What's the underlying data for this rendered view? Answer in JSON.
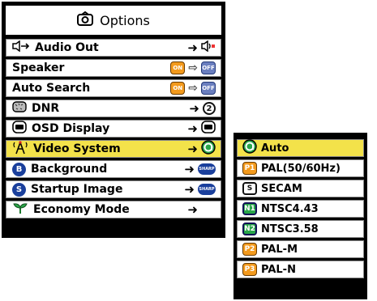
{
  "menu": {
    "title": "Options",
    "items": [
      {
        "label": "Audio Out",
        "icon": "audio-out-icon",
        "value_arrow": "➜",
        "value_icon": "speaker-out-icon",
        "selected": false
      },
      {
        "label": "Speaker",
        "icon": "",
        "value_on": "ON",
        "value_arrow": "⇨",
        "value_off": "OFF",
        "selected": false
      },
      {
        "label": "Auto Search",
        "icon": "",
        "value_on": "ON",
        "value_arrow": "⇨",
        "value_off": "OFF",
        "selected": false
      },
      {
        "label": "DNR",
        "icon": "dnr-icon",
        "value_arrow": "➜",
        "value_icon_text": "2",
        "selected": false
      },
      {
        "label": "OSD Display",
        "icon": "osd-icon",
        "value_arrow": "➜",
        "selected": false
      },
      {
        "label": "Video System",
        "icon": "video-system-icon",
        "value_arrow": "➜",
        "selected": true
      },
      {
        "label": "Background",
        "icon_text": "B",
        "value_arrow": "➜",
        "value_icon_text": "SHARP",
        "selected": false
      },
      {
        "label": "Startup Image",
        "icon_text": "S",
        "value_arrow": "➜",
        "value_icon_text": "SHARP",
        "selected": false
      },
      {
        "label": "Economy Mode",
        "icon": "economy-leaf-icon",
        "value_arrow": "➜",
        "selected": false
      }
    ]
  },
  "submenu": {
    "items": [
      {
        "icon_text": "A",
        "label": "Auto",
        "selected": true
      },
      {
        "icon_text": "P1",
        "label": "PAL(50/60Hz)",
        "selected": false
      },
      {
        "icon_text": "S",
        "label": "SECAM",
        "selected": false
      },
      {
        "icon_text": "N1",
        "label": "NTSC4.43",
        "selected": false
      },
      {
        "icon_text": "N2",
        "label": "NTSC3.58",
        "selected": false
      },
      {
        "icon_text": "P2",
        "label": "PAL-M",
        "selected": false
      },
      {
        "icon_text": "P3",
        "label": "PAL-N",
        "selected": false
      }
    ]
  },
  "colors": {
    "highlight": "#f3e24a",
    "frame": "#000000"
  }
}
